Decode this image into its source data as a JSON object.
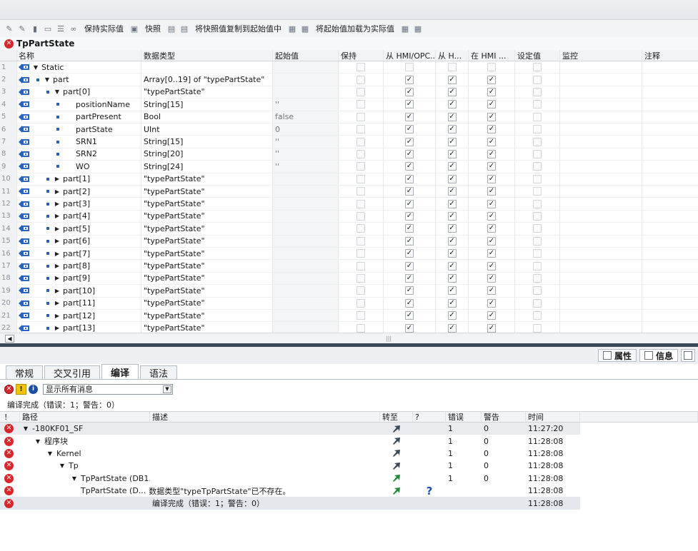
{
  "toolbar": {
    "keep_actual_label": "保持实际值",
    "snapshot_label": "快照",
    "copy_snapshot_label": "将快照值复制到起始值中",
    "load_start_label": "将起始值加载为实际值"
  },
  "block": {
    "title": "TpPartState"
  },
  "grid": {
    "headers": [
      "名称",
      "数据类型",
      "起始值",
      "保持",
      "从 HMI/OPC..",
      "从 H...",
      "在 HMI ...",
      "设定值",
      "监控",
      "注释"
    ],
    "rows": [
      {
        "num": "1",
        "name": "Static",
        "type": "",
        "start": "",
        "indent": 0,
        "tri": "▼",
        "bullet": false,
        "checks": [
          0,
          0,
          0,
          0,
          0
        ],
        "dim": true
      },
      {
        "num": "2",
        "name": "part",
        "type": "Array[0..19] of \"typePartState\"",
        "start": "",
        "indent": 0,
        "tri": "▼",
        "bullet": true,
        "checks": [
          0,
          1,
          1,
          1,
          0
        ]
      },
      {
        "num": "3",
        "name": "part[0]",
        "type": "\"typePartState\"",
        "start": "",
        "indent": 1,
        "tri": "▼",
        "bullet": true,
        "checks": [
          0,
          1,
          1,
          1,
          0
        ]
      },
      {
        "num": "4",
        "name": "positionName",
        "type": "String[15]",
        "start": "''",
        "indent": 2,
        "tri": "",
        "bullet": true,
        "checks": [
          0,
          1,
          1,
          1,
          0
        ]
      },
      {
        "num": "5",
        "name": "partPresent",
        "type": "Bool",
        "start": "false",
        "indent": 2,
        "tri": "",
        "bullet": true,
        "checks": [
          0,
          1,
          1,
          1,
          0
        ]
      },
      {
        "num": "6",
        "name": "partState",
        "type": "UInt",
        "start": "0",
        "indent": 2,
        "tri": "",
        "bullet": true,
        "checks": [
          0,
          1,
          1,
          1,
          0
        ]
      },
      {
        "num": "7",
        "name": "SRN1",
        "type": "String[15]",
        "start": "''",
        "indent": 2,
        "tri": "",
        "bullet": true,
        "checks": [
          0,
          1,
          1,
          1,
          0
        ]
      },
      {
        "num": "8",
        "name": "SRN2",
        "type": "String[20]",
        "start": "''",
        "indent": 2,
        "tri": "",
        "bullet": true,
        "checks": [
          0,
          1,
          1,
          1,
          0
        ]
      },
      {
        "num": "9",
        "name": "WO",
        "type": "String[24]",
        "start": "''",
        "indent": 2,
        "tri": "",
        "bullet": true,
        "checks": [
          0,
          1,
          1,
          1,
          0
        ]
      },
      {
        "num": "10",
        "name": "part[1]",
        "type": "\"typePartState\"",
        "start": "",
        "indent": 1,
        "tri": "▶",
        "bullet": true,
        "checks": [
          0,
          1,
          1,
          1,
          0
        ]
      },
      {
        "num": "11",
        "name": "part[2]",
        "type": "\"typePartState\"",
        "start": "",
        "indent": 1,
        "tri": "▶",
        "bullet": true,
        "checks": [
          0,
          1,
          1,
          1,
          0
        ]
      },
      {
        "num": "12",
        "name": "part[3]",
        "type": "\"typePartState\"",
        "start": "",
        "indent": 1,
        "tri": "▶",
        "bullet": true,
        "checks": [
          0,
          1,
          1,
          1,
          0
        ]
      },
      {
        "num": "13",
        "name": "part[4]",
        "type": "\"typePartState\"",
        "start": "",
        "indent": 1,
        "tri": "▶",
        "bullet": true,
        "checks": [
          0,
          1,
          1,
          1,
          0
        ]
      },
      {
        "num": "14",
        "name": "part[5]",
        "type": "\"typePartState\"",
        "start": "",
        "indent": 1,
        "tri": "▶",
        "bullet": true,
        "checks": [
          0,
          1,
          1,
          1,
          0
        ]
      },
      {
        "num": "15",
        "name": "part[6]",
        "type": "\"typePartState\"",
        "start": "",
        "indent": 1,
        "tri": "▶",
        "bullet": true,
        "checks": [
          0,
          1,
          1,
          1,
          0
        ]
      },
      {
        "num": "16",
        "name": "part[7]",
        "type": "\"typePartState\"",
        "start": "",
        "indent": 1,
        "tri": "▶",
        "bullet": true,
        "checks": [
          0,
          1,
          1,
          1,
          0
        ]
      },
      {
        "num": "17",
        "name": "part[8]",
        "type": "\"typePartState\"",
        "start": "",
        "indent": 1,
        "tri": "▶",
        "bullet": true,
        "checks": [
          0,
          1,
          1,
          1,
          0
        ]
      },
      {
        "num": "18",
        "name": "part[9]",
        "type": "\"typePartState\"",
        "start": "",
        "indent": 1,
        "tri": "▶",
        "bullet": true,
        "checks": [
          0,
          1,
          1,
          1,
          0
        ]
      },
      {
        "num": "19",
        "name": "part[10]",
        "type": "\"typePartState\"",
        "start": "",
        "indent": 1,
        "tri": "▶",
        "bullet": true,
        "checks": [
          0,
          1,
          1,
          1,
          0
        ]
      },
      {
        "num": "20",
        "name": "part[11]",
        "type": "\"typePartState\"",
        "start": "",
        "indent": 1,
        "tri": "▶",
        "bullet": true,
        "checks": [
          0,
          1,
          1,
          1,
          0
        ]
      },
      {
        "num": "21",
        "name": "part[12]",
        "type": "\"typePartState\"",
        "start": "",
        "indent": 1,
        "tri": "▶",
        "bullet": true,
        "checks": [
          0,
          1,
          1,
          1,
          0
        ]
      },
      {
        "num": "22",
        "name": "part[13]",
        "type": "\"typePartState\"",
        "start": "",
        "indent": 1,
        "tri": "▶",
        "bullet": true,
        "checks": [
          0,
          1,
          1,
          1,
          0
        ]
      }
    ]
  },
  "inspector": {
    "properties_label": "属性",
    "info_label": "信息",
    "tabs": [
      "常规",
      "交叉引用",
      "编译",
      "语法"
    ],
    "active_tab": "编译",
    "filter_value": "显示所有消息",
    "summary": "编译完成（错误：1；警告：0）"
  },
  "messages": {
    "headers": [
      "!",
      "路径",
      "描述",
      "转至",
      "?",
      "错误",
      "警告",
      "时间"
    ],
    "rows": [
      {
        "path": "-180KF01_SF",
        "desc": "",
        "indent": 0,
        "tri": "▼",
        "goto": "dark",
        "q": false,
        "err": "1",
        "warn": "0",
        "time": "11:27:20",
        "sel": true
      },
      {
        "path": "程序块",
        "desc": "",
        "indent": 1,
        "tri": "▼",
        "goto": "dark",
        "q": false,
        "err": "1",
        "warn": "0",
        "time": "11:28:08"
      },
      {
        "path": "Kernel",
        "desc": "",
        "indent": 2,
        "tri": "▼",
        "goto": "dark",
        "q": false,
        "err": "1",
        "warn": "0",
        "time": "11:28:08"
      },
      {
        "path": "Tp",
        "desc": "",
        "indent": 3,
        "tri": "▼",
        "goto": "dark",
        "q": false,
        "err": "1",
        "warn": "0",
        "time": "11:28:08"
      },
      {
        "path": "TpPartState (DB1...",
        "desc": "",
        "indent": 4,
        "tri": "▼",
        "goto": "green",
        "q": false,
        "err": "1",
        "warn": "0",
        "time": "11:28:08"
      },
      {
        "path": "TpPartState (D...",
        "desc": "数据类型\"typeTpPartState\"已不存在。",
        "indent": 5,
        "tri": "",
        "goto": "green",
        "q": true,
        "err": "",
        "warn": "",
        "time": "11:28:08",
        "combined": true
      },
      {
        "path": "",
        "desc": "编译完成（错误：1；警告：0）",
        "indent": 0,
        "tri": "",
        "goto": "",
        "q": false,
        "err": "",
        "warn": "",
        "time": "11:28:08",
        "last": true
      }
    ]
  }
}
